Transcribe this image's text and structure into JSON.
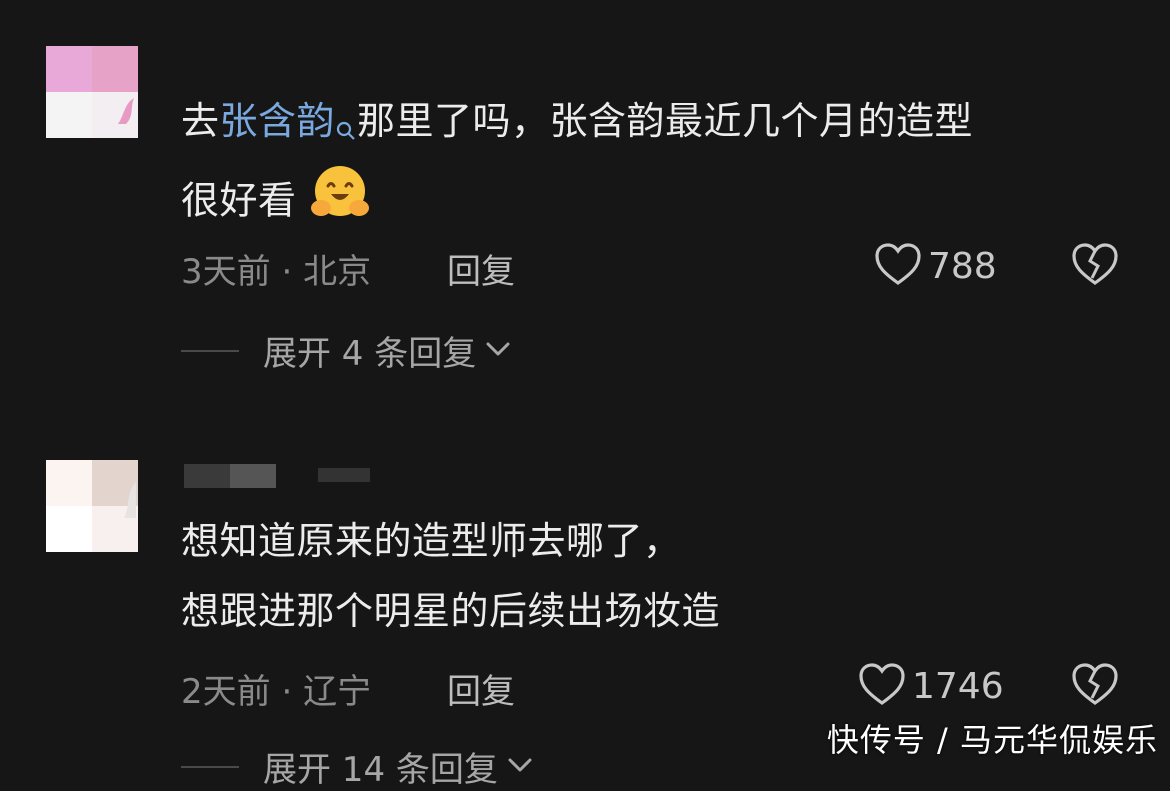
{
  "comments": [
    {
      "prefix": "去",
      "mention": "张含韵",
      "text_line1_rest": "那里了吗，张含韵最近几个月的造型",
      "text_line2": "很好看",
      "emoji": "hugging-face",
      "time": "3天前",
      "location": "北京",
      "reply_label": "回复",
      "likes": "788",
      "expand_label": "展开 4 条回复"
    },
    {
      "text_line1": "想知道原来的造型师去哪了，",
      "text_line2": "想跟进那个明星的后续出场妆造",
      "time": "2天前",
      "location": "辽宁",
      "reply_label": "回复",
      "likes": "1746",
      "expand_label": "展开 14 条回复"
    }
  ],
  "separator": "·",
  "watermark": "快传号 / 马元华侃娱乐",
  "colors": {
    "background": "#161616",
    "text": "#ececec",
    "meta": "#8a8a8a",
    "mention": "#7aa9e0"
  }
}
